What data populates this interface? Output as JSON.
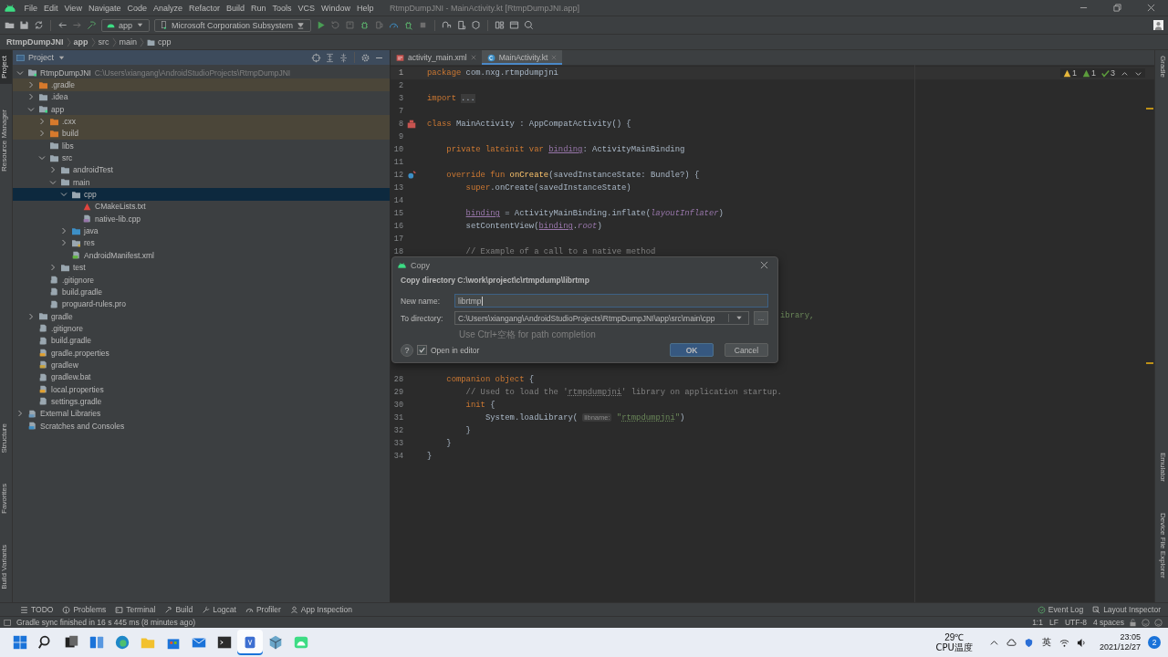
{
  "title_bar": {
    "menu": [
      "File",
      "Edit",
      "View",
      "Navigate",
      "Code",
      "Analyze",
      "Refactor",
      "Build",
      "Run",
      "Tools",
      "VCS",
      "Window",
      "Help"
    ],
    "title": "RtmpDumpJNI - MainActivity.kt [RtmpDumpJNI.app]"
  },
  "toolbar": {
    "run_config": "app",
    "device": "Microsoft Corporation Subsystem"
  },
  "breadcrumb": [
    {
      "label": "RtmpDumpJNI",
      "kind": "module"
    },
    {
      "label": "app",
      "kind": "module"
    },
    {
      "label": "src",
      "kind": "dir"
    },
    {
      "label": "main",
      "kind": "dir"
    },
    {
      "label": "cpp",
      "kind": "folder"
    }
  ],
  "left_stripe_top": [
    {
      "label": "Project",
      "selected": true
    },
    {
      "label": "Resource Manager",
      "selected": false
    }
  ],
  "left_stripe_bottom": [
    {
      "label": "Structure",
      "selected": false
    },
    {
      "label": "Favorites",
      "selected": false
    },
    {
      "label": "Build Variants",
      "selected": false
    }
  ],
  "right_stripe_top": [
    {
      "label": "Gradle",
      "selected": false
    }
  ],
  "right_stripe_bottom": [
    {
      "label": "Emulator",
      "selected": false
    },
    {
      "label": "Device File Explorer",
      "selected": false
    }
  ],
  "project_panel": {
    "title": "Project",
    "tree": [
      {
        "name": "RtmpDumpJNI",
        "path": "C:\\Users\\xiangang\\AndroidStudioProjects\\RtmpDumpJNI",
        "kind": "module",
        "expanded": true,
        "selected": false,
        "excluded": false,
        "children": [
          {
            "name": ".gradle",
            "kind": "excluded",
            "expanded": false,
            "selected": false,
            "excluded": true
          },
          {
            "name": ".idea",
            "kind": "folder",
            "expanded": false,
            "selected": false,
            "excluded": false
          },
          {
            "name": "app",
            "kind": "module",
            "expanded": true,
            "selected": false,
            "excluded": false,
            "children": [
              {
                "name": ".cxx",
                "kind": "excluded",
                "expanded": false,
                "selected": false,
                "excluded": true
              },
              {
                "name": "build",
                "kind": "excluded",
                "expanded": false,
                "selected": false,
                "excluded": true
              },
              {
                "name": "libs",
                "kind": "folder",
                "selected": false,
                "excluded": false
              },
              {
                "name": "src",
                "kind": "folder",
                "expanded": true,
                "selected": false,
                "excluded": false,
                "children": [
                  {
                    "name": "androidTest",
                    "kind": "folder",
                    "expanded": false,
                    "selected": false,
                    "excluded": false
                  },
                  {
                    "name": "main",
                    "kind": "folder",
                    "expanded": true,
                    "selected": false,
                    "excluded": false,
                    "children": [
                      {
                        "name": "cpp",
                        "kind": "folder",
                        "expanded": true,
                        "selected": true,
                        "excluded": false,
                        "children": [
                          {
                            "name": "CMakeLists.txt",
                            "kind": "cmake",
                            "selected": false,
                            "excluded": false
                          },
                          {
                            "name": "native-lib.cpp",
                            "kind": "cpp",
                            "selected": false,
                            "excluded": false
                          }
                        ]
                      },
                      {
                        "name": "java",
                        "kind": "source",
                        "expanded": false,
                        "selected": false,
                        "excluded": false
                      },
                      {
                        "name": "res",
                        "kind": "res",
                        "expanded": false,
                        "selected": false,
                        "excluded": false
                      },
                      {
                        "name": "AndroidManifest.xml",
                        "kind": "manifest",
                        "selected": false,
                        "excluded": false
                      }
                    ]
                  },
                  {
                    "name": "test",
                    "kind": "folder",
                    "expanded": false,
                    "selected": false,
                    "excluded": false
                  }
                ]
              },
              {
                "name": ".gitignore",
                "kind": "git",
                "selected": false,
                "excluded": false
              },
              {
                "name": "build.gradle",
                "kind": "gradle",
                "selected": false,
                "excluded": false
              },
              {
                "name": "proguard-rules.pro",
                "kind": "text",
                "selected": false,
                "excluded": false
              }
            ]
          },
          {
            "name": "gradle",
            "kind": "folder",
            "expanded": false,
            "selected": false,
            "excluded": false
          },
          {
            "name": ".gitignore",
            "kind": "git",
            "selected": false,
            "excluded": false
          },
          {
            "name": "build.gradle",
            "kind": "gradle",
            "selected": false,
            "excluded": false
          },
          {
            "name": "gradle.properties",
            "kind": "properties",
            "selected": false,
            "excluded": false
          },
          {
            "name": "gradlew",
            "kind": "shell",
            "selected": false,
            "excluded": false
          },
          {
            "name": "gradlew.bat",
            "kind": "text",
            "selected": false,
            "excluded": false
          },
          {
            "name": "local.properties",
            "kind": "properties",
            "selected": false,
            "excluded": false
          },
          {
            "name": "settings.gradle",
            "kind": "gradle",
            "selected": false,
            "excluded": false
          }
        ]
      },
      {
        "name": "External Libraries",
        "kind": "libraries",
        "expanded": false,
        "selected": false,
        "excluded": false
      },
      {
        "name": "Scratches and Consoles",
        "kind": "scratches",
        "selected": false,
        "excluded": false
      }
    ]
  },
  "editor": {
    "tabs": [
      {
        "label": "activity_main.xml",
        "kind": "xml",
        "selected": false
      },
      {
        "label": "MainActivity.kt",
        "kind": "kotlin",
        "selected": true
      }
    ],
    "inspections": [
      {
        "kind": "warning",
        "count": "1"
      },
      {
        "kind": "weak",
        "count": "1"
      },
      {
        "kind": "typo",
        "count": "3"
      }
    ],
    "lines": [
      {
        "kind": "code",
        "number": "1",
        "current": true,
        "segments": [
          {
            "t": "package",
            "kind": "kw"
          },
          {
            "t": " com.nxg.rtmpdumpjni",
            "kind": "plain"
          }
        ]
      },
      {
        "kind": "code",
        "number": "2",
        "current": false
      },
      {
        "kind": "code",
        "number": "3",
        "current": false,
        "segments": [
          {
            "t": "import",
            "kind": "kw"
          },
          {
            "t": "...",
            "kind": "fold"
          }
        ]
      },
      {
        "kind": "code",
        "number": "7",
        "current": false
      },
      {
        "kind": "code",
        "number": "8",
        "current": false,
        "gutter": {
          "kind": "class"
        },
        "segments": [
          {
            "t": "class",
            "kind": "kw"
          },
          {
            "t": " MainActivity : AppCompatActivity() {",
            "kind": "plain"
          }
        ]
      },
      {
        "kind": "code",
        "number": "9",
        "current": false
      },
      {
        "kind": "code",
        "number": "10",
        "current": false,
        "segments": [
          {
            "t": "    private lateinit var ",
            "kind": "kw"
          },
          {
            "t": "binding",
            "kind": "prop"
          },
          {
            "t": ": ActivityMainBinding",
            "kind": "plain"
          }
        ]
      },
      {
        "kind": "code",
        "number": "11",
        "current": false
      },
      {
        "kind": "code",
        "number": "12",
        "current": false,
        "gutter": {
          "kind": "override"
        },
        "segments": [
          {
            "t": "    override fun ",
            "kind": "kw"
          },
          {
            "t": "onCreate",
            "kind": "fn"
          },
          {
            "t": "(savedInstanceState: Bundle?) {",
            "kind": "plain"
          }
        ]
      },
      {
        "kind": "code",
        "number": "13",
        "current": false,
        "segments": [
          {
            "t": "        super",
            "kind": "kw"
          },
          {
            "t": ".onCreate(savedInstanceState)",
            "kind": "plain"
          }
        ]
      },
      {
        "kind": "code",
        "number": "14",
        "current": false
      },
      {
        "kind": "code",
        "number": "15",
        "current": false,
        "segments": [
          {
            "t": "        binding",
            "kind": "prop"
          },
          {
            "t": " = ActivityMainBinding.inflate(",
            "kind": "plain"
          },
          {
            "t": "layoutInflater",
            "kind": "ital"
          },
          {
            "t": ")",
            "kind": "plain"
          }
        ]
      },
      {
        "kind": "code",
        "number": "16",
        "current": false,
        "segments": [
          {
            "t": "        setContentView(",
            "kind": "plain"
          },
          {
            "t": "binding",
            "kind": "prop"
          },
          {
            "t": ".",
            "kind": "plain"
          },
          {
            "t": "root",
            "kind": "ital"
          },
          {
            "t": ")",
            "kind": "plain"
          }
        ]
      },
      {
        "kind": "code",
        "number": "17",
        "current": false
      },
      {
        "kind": "code",
        "number": "18",
        "current": false,
        "segments": [
          {
            "t": "        // Example of a call to a native method",
            "kind": "comment"
          }
        ]
      },
      {
        "kind": "covered"
      },
      {
        "kind": "covered"
      },
      {
        "kind": "covered"
      },
      {
        "kind": "covered"
      },
      {
        "kind": "clipped",
        "segments": [
          {
            "t": "ibrary,",
            "kind": "str"
          }
        ]
      },
      {
        "kind": "covered"
      },
      {
        "kind": "covered"
      },
      {
        "kind": "covered"
      },
      {
        "kind": "covered"
      },
      {
        "kind": "code",
        "number": "28",
        "current": false,
        "segments": [
          {
            "t": "    companion object",
            "kind": "kw"
          },
          {
            "t": " {",
            "kind": "plain"
          }
        ]
      },
      {
        "kind": "code",
        "number": "29",
        "current": false,
        "segments": [
          {
            "t": "        // Used to load the '",
            "kind": "comment"
          },
          {
            "t": "rtmpdumpjni",
            "kind": "commentu"
          },
          {
            "t": "' library on application startup.",
            "kind": "comment"
          }
        ]
      },
      {
        "kind": "code",
        "number": "30",
        "current": false,
        "segments": [
          {
            "t": "        init",
            "kind": "kw"
          },
          {
            "t": " {",
            "kind": "plain"
          }
        ]
      },
      {
        "kind": "code",
        "number": "31",
        "current": false,
        "segments": [
          {
            "t": "            System.loadLibrary(",
            "kind": "plain"
          },
          {
            "t": "libname:",
            "kind": "hint"
          },
          {
            "t": " \"",
            "kind": "str"
          },
          {
            "t": "rtmpdumpjni",
            "kind": "stru"
          },
          {
            "t": "\"",
            "kind": "str"
          },
          {
            "t": ")",
            "kind": "plain"
          }
        ]
      },
      {
        "kind": "code",
        "number": "32",
        "current": false,
        "segments": [
          {
            "t": "        }",
            "kind": "plain"
          }
        ]
      },
      {
        "kind": "code",
        "number": "33",
        "current": false,
        "segments": [
          {
            "t": "    }",
            "kind": "plain"
          }
        ]
      },
      {
        "kind": "code",
        "number": "34",
        "current": false,
        "segments": [
          {
            "t": "}",
            "kind": "plain"
          }
        ]
      }
    ]
  },
  "dialog": {
    "title": "Copy",
    "heading": "Copy directory C:\\work\\project\\c\\rtmpdump\\librtmp",
    "new_name": {
      "label": "New name:",
      "value": "librtmp",
      "focused": true
    },
    "to_directory": {
      "label": "To directory:",
      "value": "C:\\Users\\xiangang\\AndroidStudioProjects\\RtmpDumpJNI\\app\\src\\main\\cpp",
      "browse": "..."
    },
    "hint": "Use Ctrl+空格 for path completion",
    "help": "?",
    "open_in_editor": {
      "label": "Open in editor",
      "checked": true
    },
    "buttons": [
      {
        "label": "OK",
        "default": true
      },
      {
        "label": "Cancel",
        "default": false
      }
    ]
  },
  "tool_tabs_left": [
    {
      "label": "TODO",
      "kind": "todo"
    },
    {
      "label": "Problems",
      "kind": "problems"
    },
    {
      "label": "Terminal",
      "kind": "terminal"
    },
    {
      "label": "Build",
      "kind": "build"
    },
    {
      "label": "Logcat",
      "kind": "logcat"
    },
    {
      "label": "Profiler",
      "kind": "profiler"
    },
    {
      "label": "App Inspection",
      "kind": "inspection"
    }
  ],
  "tool_tabs_right": [
    {
      "label": "Event Log",
      "kind": "eventlog"
    },
    {
      "label": "Layout Inspector",
      "kind": "layout"
    }
  ],
  "status_bar": {
    "message": "Gradle sync finished in 16 s 445 ms (8 minutes ago)",
    "items": [
      "1:1",
      "LF",
      "UTF-8",
      "4 spaces"
    ]
  },
  "taskbar": {
    "apps": [
      {
        "kind": "start",
        "selected": false
      },
      {
        "kind": "search",
        "selected": false
      },
      {
        "kind": "taskview",
        "selected": false
      },
      {
        "kind": "widgets",
        "selected": false
      },
      {
        "kind": "edge",
        "selected": false
      },
      {
        "kind": "explorer",
        "selected": false
      },
      {
        "kind": "store",
        "selected": false
      },
      {
        "kind": "mail",
        "selected": false
      },
      {
        "kind": "terminal",
        "selected": false
      },
      {
        "kind": "studio",
        "selected": true
      },
      {
        "kind": "box",
        "selected": false
      },
      {
        "kind": "android",
        "selected": false
      }
    ],
    "temperature": "29℃",
    "sensor": "CPU温度",
    "ime": "英",
    "time": "23:05",
    "date": "2021/12/27",
    "notifications": "2"
  }
}
